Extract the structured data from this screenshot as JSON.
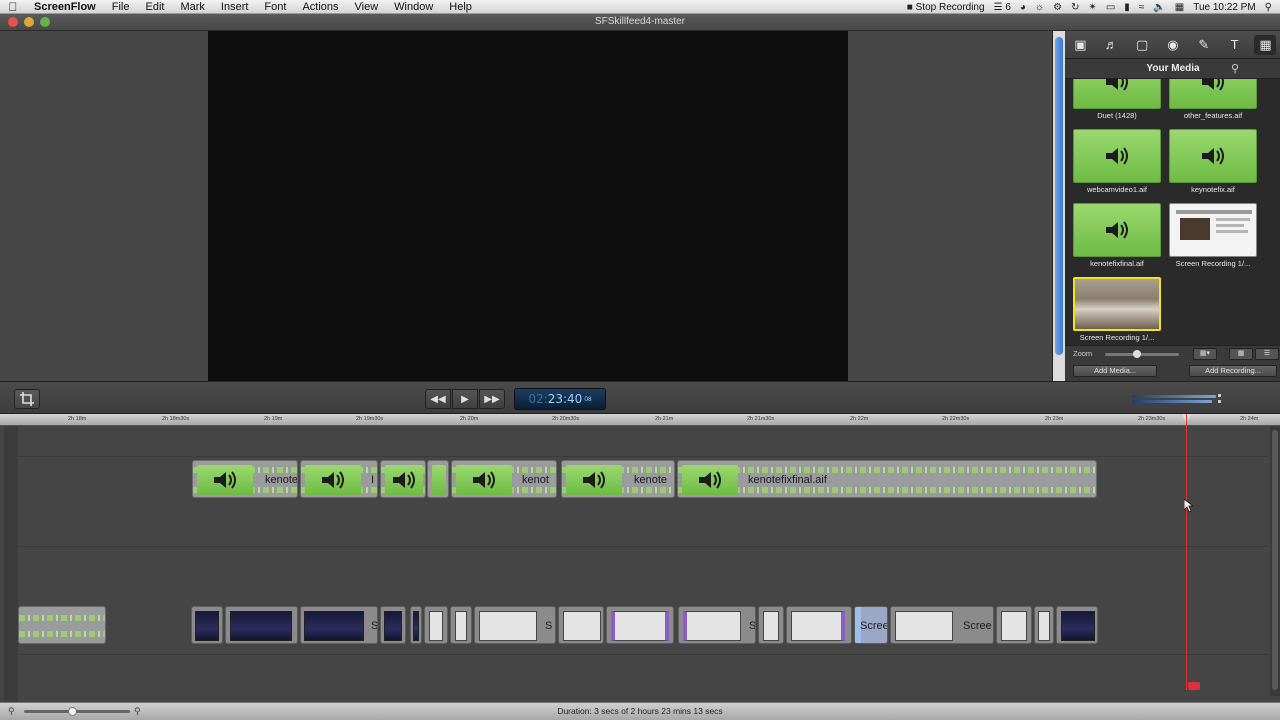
{
  "menubar": {
    "app_name": "ScreenFlow",
    "items": [
      "File",
      "Edit",
      "Mark",
      "Insert",
      "Font",
      "Actions",
      "View",
      "Window",
      "Help"
    ],
    "stop_recording": "Stop Recording",
    "status_count": "6",
    "clock": "Tue 10:22 PM"
  },
  "window": {
    "title": "SFSkillfeed4-master"
  },
  "media_panel": {
    "title": "Your Media",
    "items": [
      {
        "label": "Duet (1428)",
        "kind": "audio"
      },
      {
        "label": "other_features.aif",
        "kind": "audio"
      },
      {
        "label": "webcamvideo1.aif",
        "kind": "audio"
      },
      {
        "label": "keynotefix.aif",
        "kind": "audio"
      },
      {
        "label": "kenotefixfinal.aif",
        "kind": "audio"
      },
      {
        "label": "Screen Recording 1/...",
        "kind": "screen"
      },
      {
        "label": "Screen Recording 1/...",
        "kind": "video"
      }
    ],
    "zoom_label": "Zoom",
    "add_media": "Add Media...",
    "add_recording": "Add Recording..."
  },
  "timecode": {
    "hours": "02:",
    "main": "23:40",
    "frames": "08"
  },
  "ruler": {
    "ticks": [
      "2h 18m",
      "2h 18m30s",
      "2h 19m",
      "2h 19m30s",
      "2h 20m",
      "2h 20m30s",
      "2h 21m",
      "2h 21m30s",
      "2h 22m",
      "2h 22m30s",
      "2h 23m",
      "2h 23m30s",
      "2h 24m"
    ]
  },
  "audio_clips": [
    {
      "label": "kenote"
    },
    {
      "label": "I"
    },
    {
      "label": ""
    },
    {
      "label": "kenot"
    },
    {
      "label": "kenote"
    },
    {
      "label": "kenotefixfinal.aif"
    }
  ],
  "video_labels": {
    "s1": "S",
    "s2": "S",
    "s3": "S",
    "scree1": "Scree",
    "scree2": "Scree"
  },
  "status": {
    "duration": "Duration: 3 secs of 2 hours 23 mins 13 secs"
  },
  "colors": {
    "accent": "#6fbb45",
    "playhead": "#d33333",
    "timecode_bg": "#0b1f36"
  }
}
